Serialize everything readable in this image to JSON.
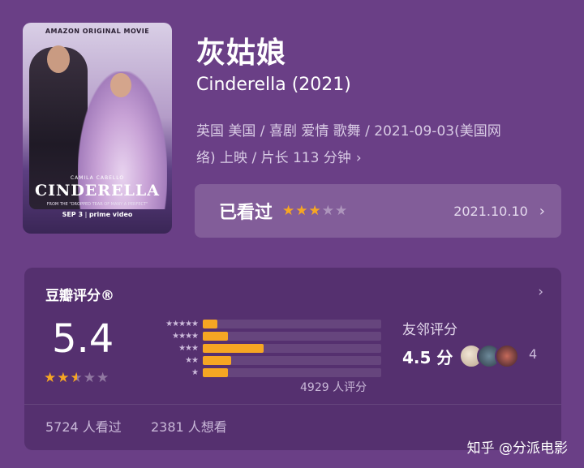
{
  "poster": {
    "studio": "AMAZON ORIGINAL MOVIE",
    "actress": "CAMILA CABELLO",
    "title": "CINDERELLA",
    "tagline": "FROM THE \"DROPPED TEAR OF MANY A PERFECT\"",
    "release_date": "SEP 3",
    "service": "prime video"
  },
  "movie": {
    "title_cn": "灰姑娘",
    "title_en": "Cinderella (2021)",
    "meta_line1": "英国 美国 / 喜剧 爱情 歌舞 / 2021-09-03(美国网",
    "meta_line2": "络) 上映 / 片长 113 分钟",
    "meta_chevron": "›"
  },
  "watched": {
    "label": "已看过",
    "rating": 3,
    "max": 5,
    "date": "2021.10.10",
    "arrow": "›"
  },
  "rating_card": {
    "header": "豆瓣评分®",
    "arrow": "›",
    "score": "5.4",
    "stars": 2.5,
    "distribution": [
      {
        "stars": "★★★★★",
        "value": 0.08
      },
      {
        "stars": "★★★★",
        "value": 0.14
      },
      {
        "stars": "★★★",
        "value": 0.34
      },
      {
        "stars": "★★",
        "value": 0.16
      },
      {
        "stars": "★",
        "value": 0.14
      }
    ],
    "rating_count": "4929 人评分",
    "friends_label": "友邻评分",
    "friends_score": "4.5 分",
    "friends_count": "4",
    "seen": "5724 人看过",
    "want": "2381 人想看",
    "icons": {
      "friend_avatars": [
        "avatar",
        "avatar",
        "avatar"
      ]
    }
  },
  "watermark": "知乎 @分派电影",
  "colors": {
    "background": "#6a3f86",
    "card": "#55306f",
    "star": "#f6a623"
  }
}
